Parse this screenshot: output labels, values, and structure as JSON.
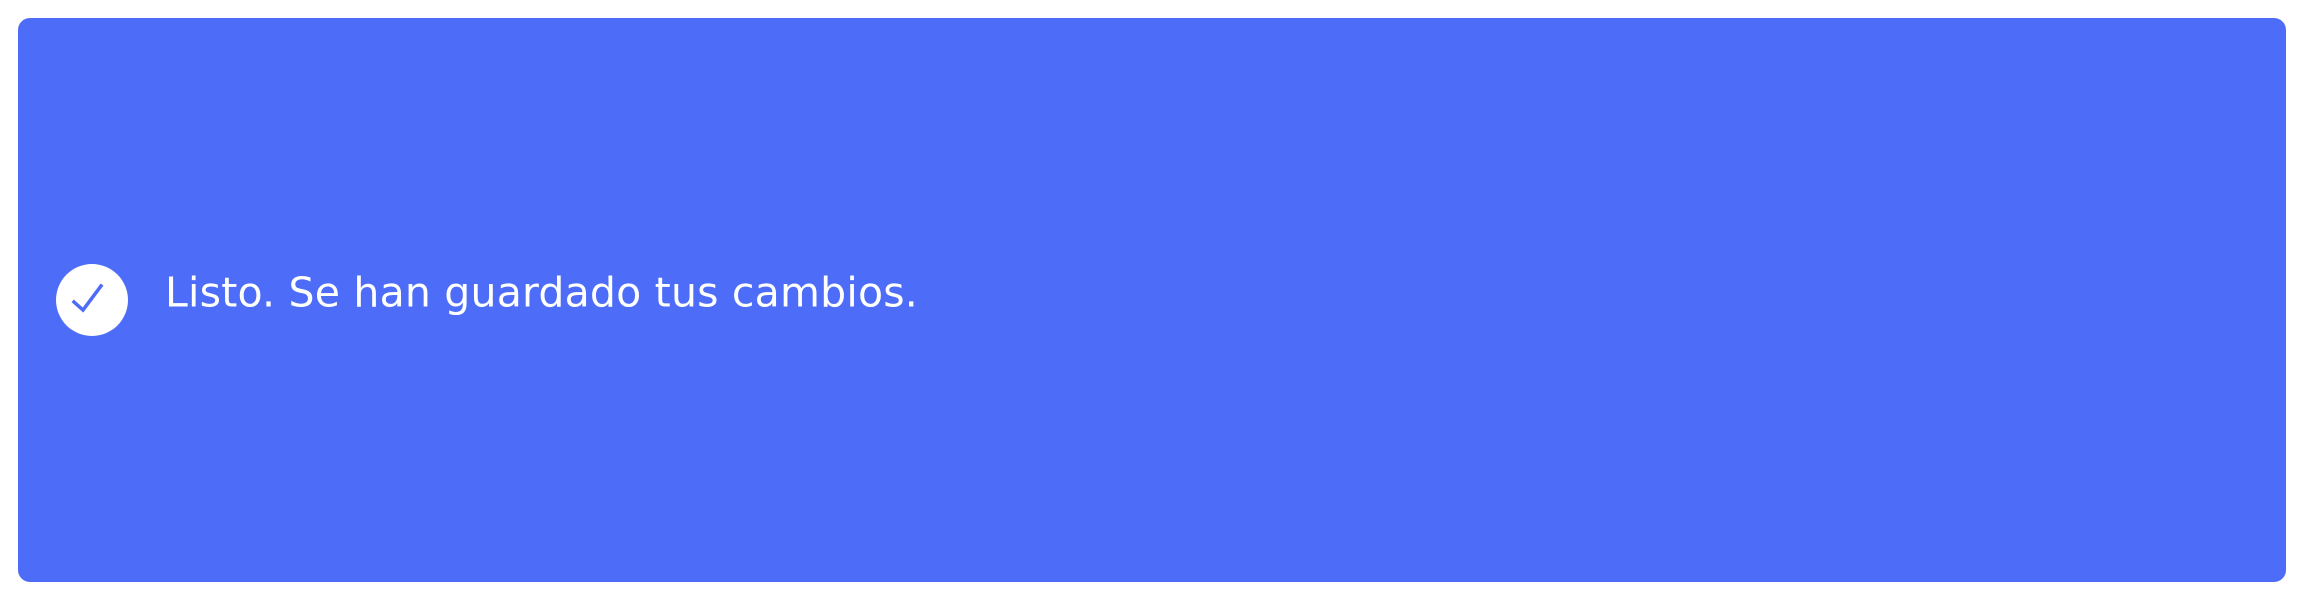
{
  "toast": {
    "message": "Listo. Se han guardado tus cambios.",
    "icon": "check-circle-icon",
    "background_color": "#4d6cf8",
    "text_color": "#ffffff",
    "icon_circle_color": "#ffffff"
  }
}
